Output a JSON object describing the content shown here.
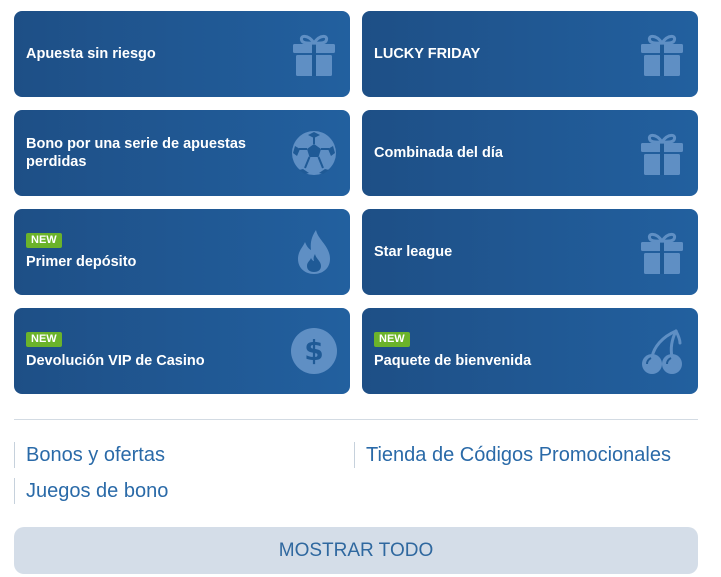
{
  "cards": [
    {
      "label": "Apuesta sin riesgo",
      "badge": "",
      "icon": "gift-icon"
    },
    {
      "label": "LUCKY FRIDAY",
      "badge": "",
      "icon": "gift-icon"
    },
    {
      "label": "Bono por una serie de apuestas perdidas",
      "badge": "",
      "icon": "soccer-ball-icon"
    },
    {
      "label": "Combinada del día",
      "badge": "",
      "icon": "gift-icon"
    },
    {
      "label": "Primer depósito",
      "badge": "NEW",
      "icon": "flame-icon"
    },
    {
      "label": "Star league",
      "badge": "",
      "icon": "gift-icon"
    },
    {
      "label": "Devolución VIP de Casino",
      "badge": "NEW",
      "icon": "dollar-coin-icon"
    },
    {
      "label": "Paquete de bienvenida",
      "badge": "NEW",
      "icon": "cherries-icon"
    }
  ],
  "links": {
    "bonos": "Bonos y ofertas",
    "tienda": "Tienda de Códigos Promocionales",
    "juegos": "Juegos de bono"
  },
  "show_all_label": "MOSTRAR TODO",
  "colors": {
    "card_start": "#1e4f86",
    "card_end": "#22609f",
    "badge": "#6bb32a",
    "link": "#2a6aa8",
    "button_bg": "#d4dde8"
  }
}
